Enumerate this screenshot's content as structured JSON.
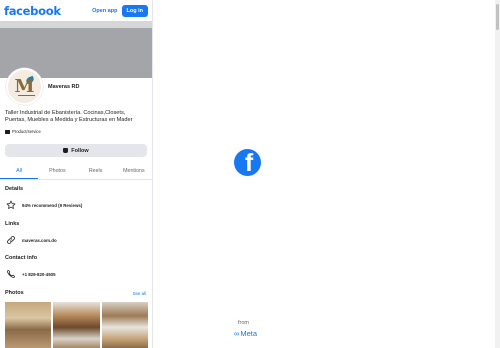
{
  "header": {
    "logo": "facebook",
    "open_app": "Open app",
    "login": "Log in"
  },
  "profile": {
    "avatar_monogram": "M",
    "name": "Maveras RD",
    "description": "Taller Industrial de Ebanistería. Cocinas,Closets, Puertas, Muebles a Medida y Estructuras en Mader",
    "category": "Product/service",
    "follow_label": "Follow"
  },
  "tabs": [
    "All",
    "Photos",
    "Reels",
    "Mentions"
  ],
  "sections": {
    "details": {
      "title": "Details",
      "recommend": "94% recommend (9 Reviews)"
    },
    "links": {
      "title": "Links",
      "website": "maveras.com.do"
    },
    "contact": {
      "title": "Contact info",
      "phone": "+1 829-820-4505"
    },
    "photos": {
      "title": "Photos",
      "see_all": "See all"
    }
  },
  "splash": {
    "from": "from",
    "meta": "Meta"
  },
  "colors": {
    "brand_blue": "#1877f2",
    "button_gray": "#e4e6eb"
  }
}
